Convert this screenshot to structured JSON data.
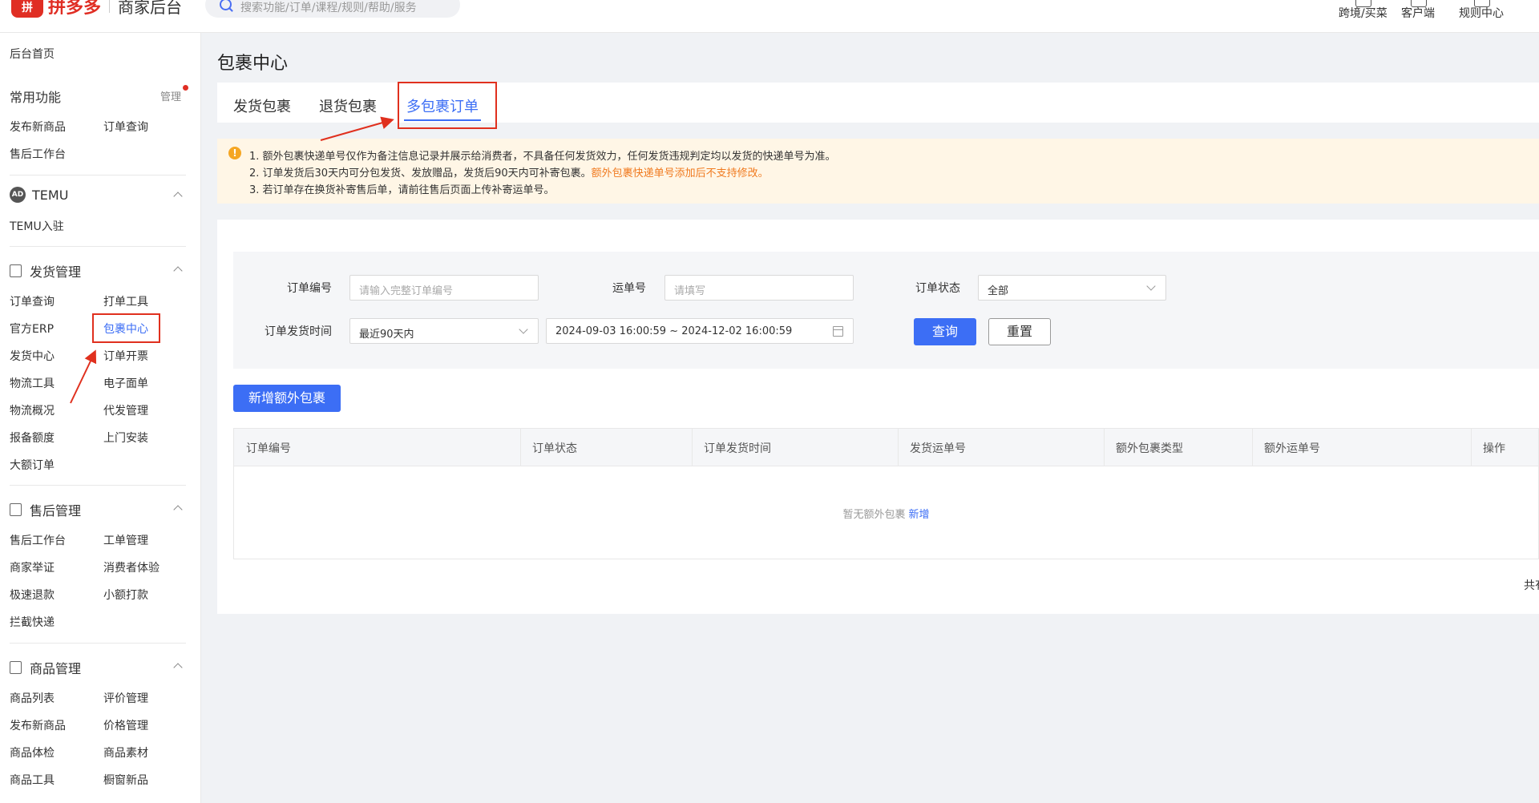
{
  "header": {
    "logo_mark": "拼",
    "logo_name": "拼多多",
    "logo_sub": "商家后台",
    "search_placeholder": "搜索功能/订单/课程/规则/帮助/服务",
    "links": [
      "跨境/买菜",
      "客户端",
      "规则中心"
    ]
  },
  "sidebar": {
    "home": "后台首页",
    "common": {
      "title": "常用功能",
      "manage": "管理",
      "items": [
        "发布新商品",
        "订单查询",
        "售后工作台"
      ]
    },
    "temu": {
      "badge": "AD",
      "title": "TEMU",
      "items": [
        "TEMU入驻"
      ]
    },
    "shipping": {
      "title": "发货管理",
      "items": [
        "订单查询",
        "打单工具",
        "官方ERP",
        "包裹中心",
        "发货中心",
        "订单开票",
        "物流工具",
        "电子面单",
        "物流概况",
        "代发管理",
        "报备额度",
        "上门安装",
        "大额订单"
      ]
    },
    "aftersale": {
      "title": "售后管理",
      "items": [
        "售后工作台",
        "工单管理",
        "商家举证",
        "消费者体验",
        "极速退款",
        "小额打款",
        "拦截快递"
      ]
    },
    "goods": {
      "title": "商品管理",
      "items": [
        "商品列表",
        "评价管理",
        "发布新商品",
        "价格管理",
        "商品体检",
        "商品素材",
        "商品工具",
        "橱窗新品"
      ]
    }
  },
  "main": {
    "title": "包裹中心",
    "tabs": [
      "发货包裹",
      "退货包裹",
      "多包裹订单"
    ],
    "active_tab": 2,
    "notice": {
      "line1": "1. 额外包裹快递单号仅作为备注信息记录并展示给消费者，不具备任何发货效力，任何发货违规判定均以发货的快递单号为准。",
      "line2_a": "2. 订单发货后30天内可分包发货、发放赠品，发货后90天内可补寄包裹。",
      "line2_b": "额外包裹快递单号添加后不支持修改。",
      "line3": "3. 若订单存在换货补寄售后单，请前往售后页面上传补寄运单号。"
    },
    "filter": {
      "order_no_label": "订单编号",
      "order_no_placeholder": "请输入完整订单编号",
      "waybill_label": "运单号",
      "waybill_placeholder": "请填写",
      "status_label": "订单状态",
      "status_value": "全部",
      "time_label": "订单发货时间",
      "time_range_value": "最近90天内",
      "date_range": "2024-09-03 16:00:59 ~ 2024-12-02 16:00:59",
      "query_btn": "查询",
      "reset_btn": "重置"
    },
    "add_btn": "新增额外包裹",
    "table": {
      "columns": [
        "订单编号",
        "订单状态",
        "订单发货时间",
        "发货运单号",
        "额外包裹类型",
        "额外运单号",
        "操作"
      ],
      "empty_text": "暂无额外包裹",
      "empty_link": "新增"
    },
    "total": "共有"
  },
  "colors": {
    "brand": "#e02e24",
    "accent": "#3c6ef5",
    "notice_bg": "#fff6e6",
    "highlight_text": "#f07a1f",
    "annotation": "#e0301e"
  }
}
